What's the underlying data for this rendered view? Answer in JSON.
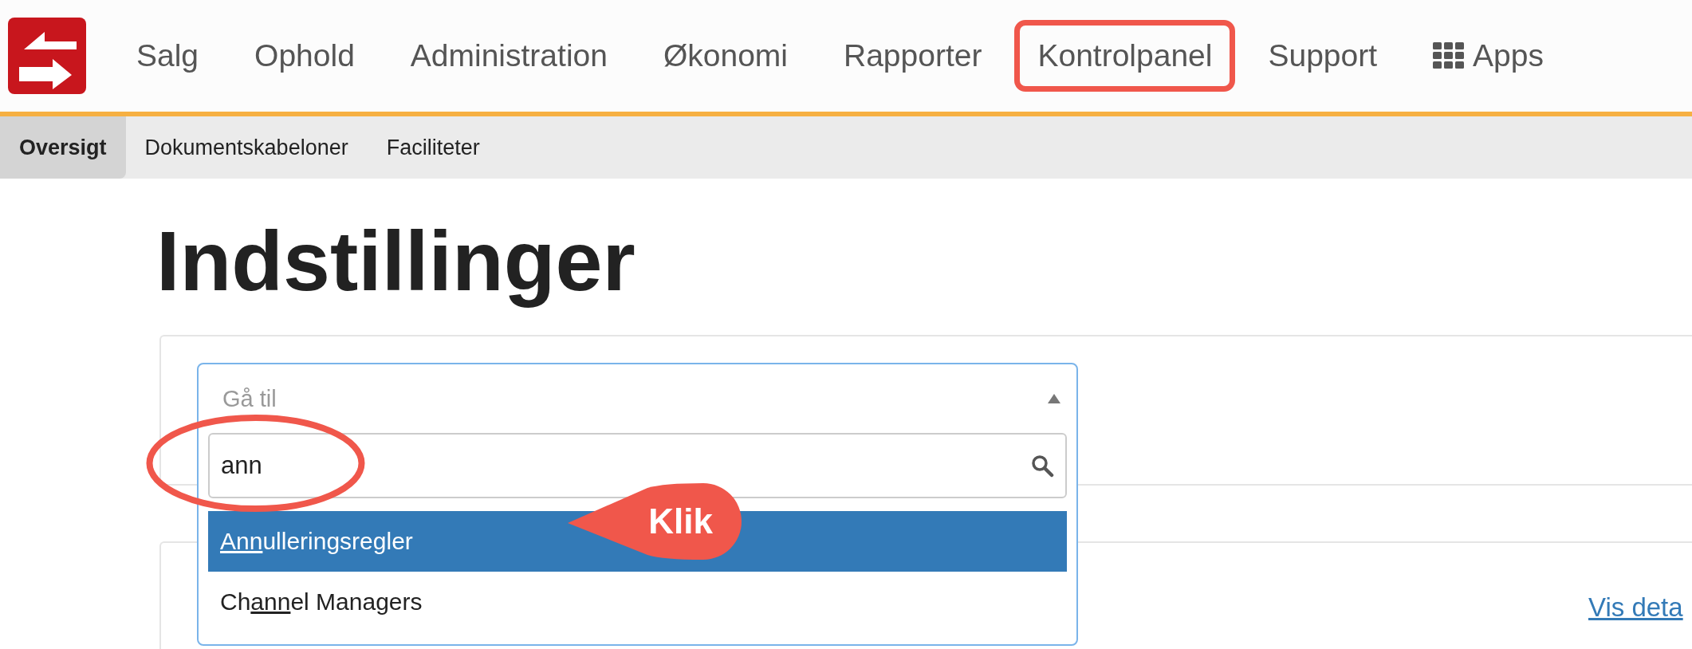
{
  "nav": {
    "items": [
      {
        "label": "Salg",
        "annotated": false,
        "kind": "text"
      },
      {
        "label": "Ophold",
        "annotated": false,
        "kind": "text"
      },
      {
        "label": "Administration",
        "annotated": false,
        "kind": "text"
      },
      {
        "label": "Økonomi",
        "annotated": false,
        "kind": "text"
      },
      {
        "label": "Rapporter",
        "annotated": false,
        "kind": "text"
      },
      {
        "label": "Kontrolpanel",
        "annotated": true,
        "kind": "text"
      },
      {
        "label": "Support",
        "annotated": false,
        "kind": "text"
      },
      {
        "label": "Apps",
        "annotated": false,
        "kind": "apps"
      }
    ]
  },
  "subnav": {
    "tabs": [
      {
        "label": "Oversigt",
        "selected": true
      },
      {
        "label": "Dokumentskabeloner",
        "selected": false
      },
      {
        "label": "Faciliteter",
        "selected": false
      }
    ]
  },
  "heading": "Indstillinger",
  "goto": {
    "placeholder": "Gå til",
    "search_value": "ann",
    "options": [
      {
        "selected": true,
        "parts": [
          {
            "text": "Ann",
            "matched": true
          },
          {
            "text": "ulleringsregler",
            "matched": false
          }
        ]
      },
      {
        "selected": false,
        "parts": [
          {
            "text": "Ch",
            "matched": false
          },
          {
            "text": "ann",
            "matched": true
          },
          {
            "text": "el Managers",
            "matched": false
          }
        ]
      }
    ]
  },
  "details_link": "Vis deta",
  "annotations": [
    {
      "kind": "ellipse"
    },
    {
      "kind": "callout",
      "label": "Klik"
    }
  ]
}
